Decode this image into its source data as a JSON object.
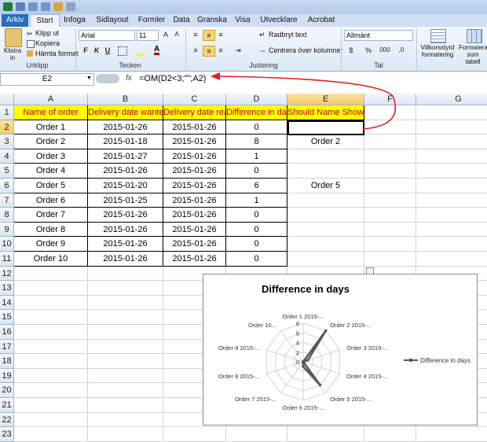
{
  "title_tabs": [
    "Arkiv",
    "Start",
    "Infoga",
    "Sidlayout",
    "Formler",
    "Data",
    "Granska",
    "Visa",
    "Utvecklare",
    "Acrobat"
  ],
  "active_tab": "Start",
  "ribbon": {
    "clipboard": {
      "paste": "Klistra in",
      "cut": "Klipp ut",
      "copy": "Kopiera",
      "format_painter": "Hämta format",
      "label": "Urklipp"
    },
    "font": {
      "name": "Arial",
      "size": "11",
      "bold": "F",
      "italic": "K",
      "underline": "U",
      "label": "Tecken"
    },
    "alignment": {
      "wrap": "Radbryt text",
      "merge": "Centrera över kolumner",
      "label": "Justering"
    },
    "number": {
      "format": "Allmänt",
      "percent": "%",
      "thousands": "000",
      "label": "Tal"
    },
    "styles": {
      "conditional": "Villkorsstyrd formatering",
      "table": "Formatera som tabell"
    }
  },
  "formula_bar": {
    "name_box": "E2",
    "fx": "fx",
    "formula": "=OM(D2<3;\"\";A2)"
  },
  "columns": [
    "A",
    "B",
    "C",
    "D",
    "E",
    "F",
    "G"
  ],
  "rows": [
    "1",
    "2",
    "3",
    "4",
    "5",
    "6",
    "7",
    "8",
    "9",
    "10",
    "11",
    "12",
    "13",
    "14",
    "15",
    "16",
    "17",
    "18",
    "19",
    "20",
    "21",
    "22",
    "23"
  ],
  "headers": [
    "Name of order",
    "Delivery date wanted",
    "Delivery date real",
    "Difference in days",
    "Should Name Show?"
  ],
  "table": [
    [
      "Order 1",
      "2015-01-26",
      "2015-01-26",
      "0",
      ""
    ],
    [
      "Order 2",
      "2015-01-18",
      "2015-01-26",
      "8",
      "Order 2"
    ],
    [
      "Order 3",
      "2015-01-27",
      "2015-01-26",
      "1",
      ""
    ],
    [
      "Order 4",
      "2015-01-26",
      "2015-01-26",
      "0",
      ""
    ],
    [
      "Order 5",
      "2015-01-20",
      "2015-01-26",
      "6",
      "Order 5"
    ],
    [
      "Order 6",
      "2015-01-25",
      "2015-01-26",
      "1",
      ""
    ],
    [
      "Order 7",
      "2015-01-26",
      "2015-01-26",
      "0",
      ""
    ],
    [
      "Order 8",
      "2015-01-26",
      "2015-01-26",
      "0",
      ""
    ],
    [
      "Order 9",
      "2015-01-26",
      "2015-01-26",
      "0",
      ""
    ],
    [
      "Order 10",
      "2015-01-26",
      "2015-01-26",
      "0",
      ""
    ]
  ],
  "chart_data": {
    "type": "radar",
    "title": "Difference in days",
    "categories": [
      "Order 1 2015-...",
      "Order 2 2015-...",
      "Order 3 2015-...",
      "Order 4 2015-...",
      "Order 5 2015-...",
      "Order 6 2015-...",
      "Order 7 2015-...",
      "Order 8 2015-...",
      "Order 9 2015-...",
      "Order 10..."
    ],
    "series": [
      {
        "name": "Difference in days",
        "values": [
          0,
          8,
          1,
          0,
          6,
          1,
          0,
          0,
          0,
          0
        ],
        "color": "#595959"
      }
    ],
    "rlim": [
      0,
      8
    ],
    "ticks": [
      "0",
      "2",
      "4",
      "6",
      "8"
    ],
    "legend": "right"
  },
  "colors": {
    "header_fill": "#ffff00",
    "header_text": "#c00000",
    "arrow": "#e02020",
    "accent": "#2a6cc0"
  }
}
